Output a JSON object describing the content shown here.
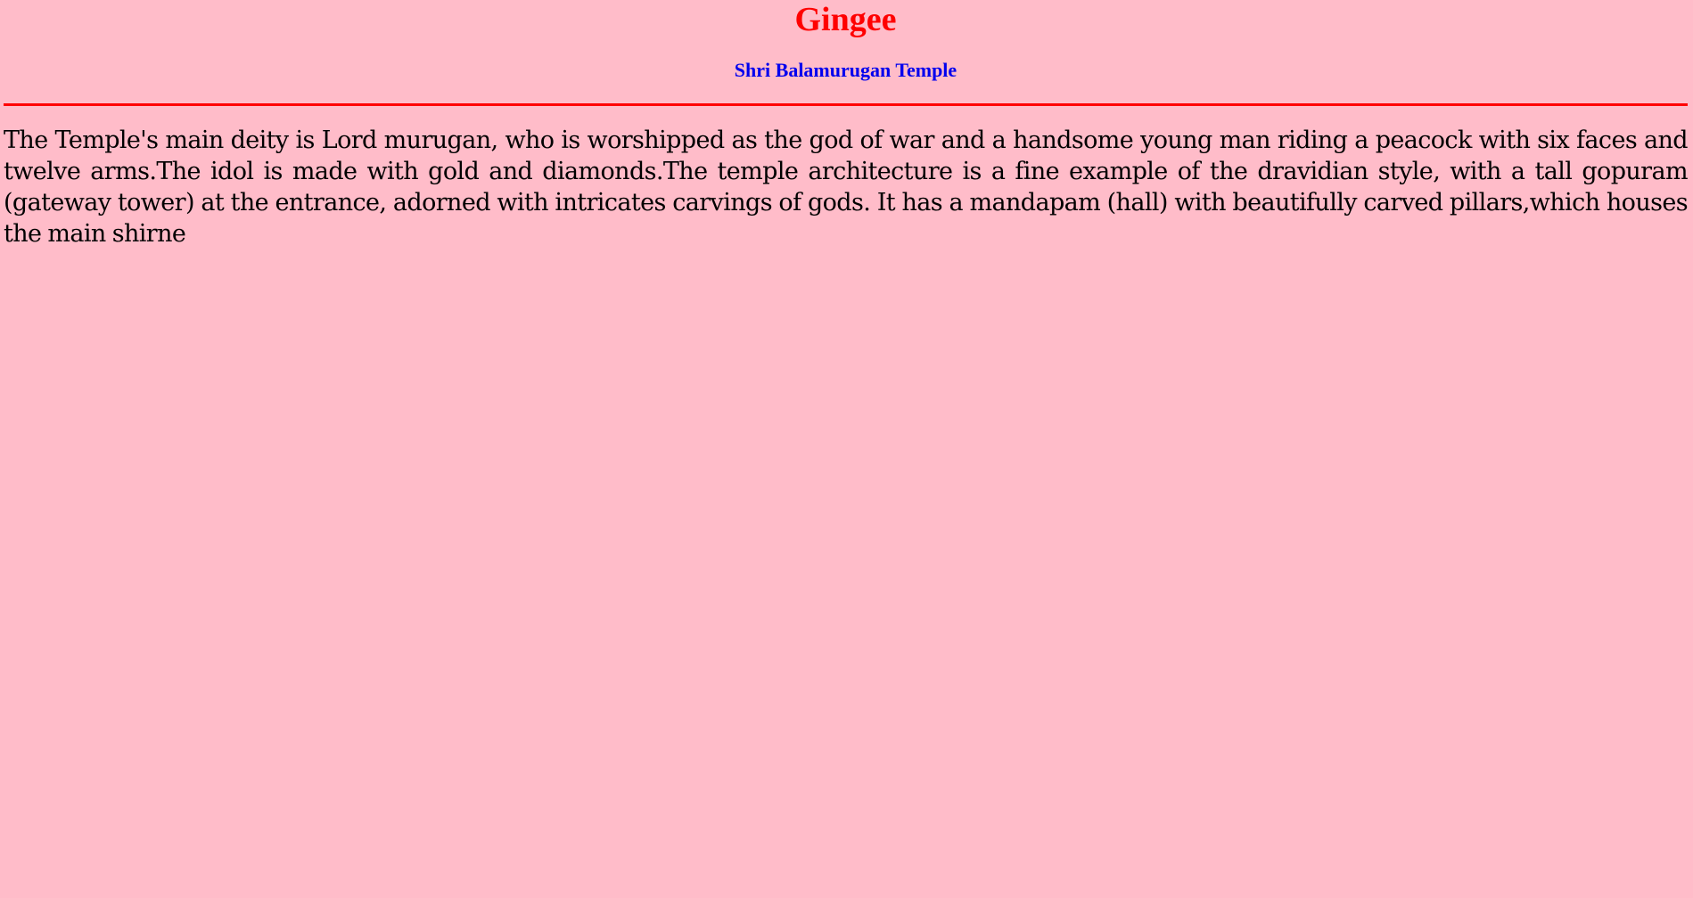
{
  "page": {
    "title": "Gingee",
    "subtitle": "Shri Balamurugan Temple",
    "paragraph": "The Temple's main deity is Lord murugan, who is worshipped as the god of war and a handsome young man riding a peacock with six faces and twelve arms.The idol is made with gold and diamonds.The temple architecture is a fine example of the dravidian style, with a tall gopuram (gateway tower) at the entrance, adorned with intricates carvings of gods. It has a mandapam (hall) with beautifully carved pillars,which houses the main shirne"
  },
  "colors": {
    "background": "#ffbcc9",
    "title": "#ff0000",
    "subtitle": "#0000ee",
    "rule": "#ff0000",
    "text": "#000000"
  }
}
